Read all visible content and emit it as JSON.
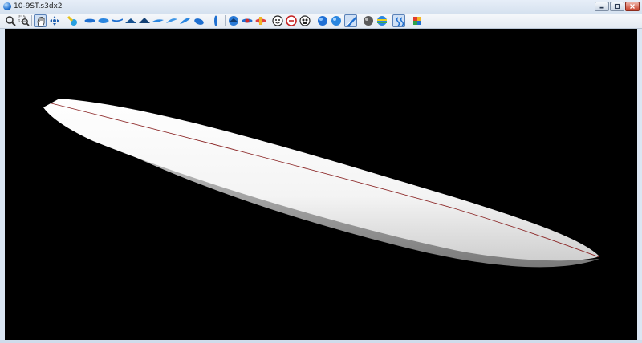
{
  "window": {
    "title": "10-9ST.s3dx2",
    "app_icon": "blue-sphere-icon",
    "controls": [
      "minimize-icon",
      "maximize-icon",
      "close-icon"
    ]
  },
  "toolbar": {
    "buttons": [
      "zoom-icon",
      "zoom-window-icon",
      "pan-hand-icon",
      "rotate-icon",
      "color-pick-icon",
      "top-view-icon",
      "bottom-view-icon",
      "side-view-icon",
      "profile-view-icon",
      "tail-view-icon",
      "nose-view-icon",
      "perspective-view-icon",
      "view-variant-icon",
      "view-variant-icon",
      "view-variant-icon",
      "view-variant-icon",
      "vertical-view-icon",
      "rocker-icon",
      "fins-icon",
      "fins-color-icon",
      "face-icon",
      "lifebuoy-icon",
      "skull-icon",
      "blue-sphere-icon",
      "blue-sphere-icon",
      "edit-surface-icon",
      "shaded-sphere-icon",
      "striped-sphere-icon",
      "mirror-icon",
      "color-grid-icon"
    ],
    "active": [
      "pan-hand-icon",
      "edit-surface-icon",
      "mirror-icon"
    ]
  },
  "viewport": {
    "background": "#000000",
    "object": "surfboard-3d-model",
    "board_color": "#f4f4f4",
    "stringer_color": "#8b2525"
  }
}
